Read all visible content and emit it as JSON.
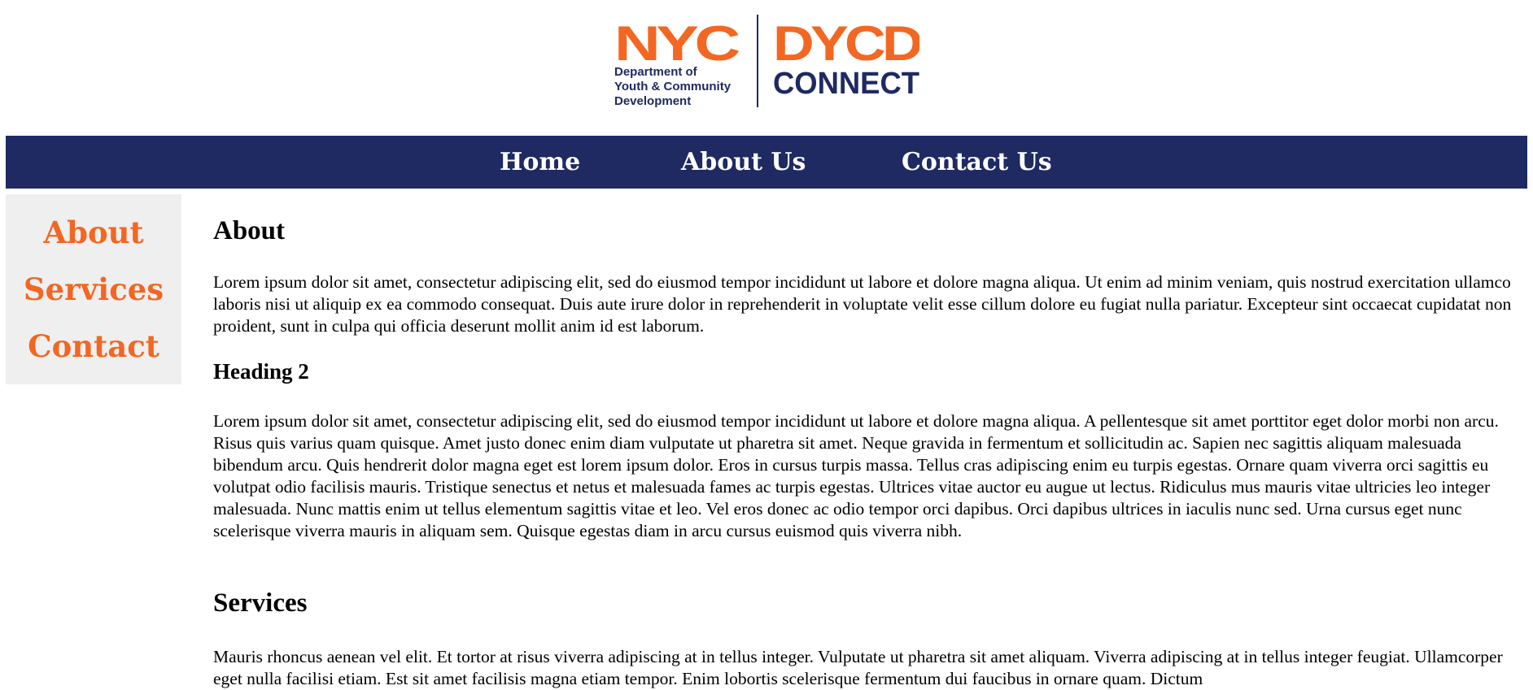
{
  "logo": {
    "nyc": "NYC",
    "dept_lines": [
      "Department of",
      "Youth & Community",
      "Development"
    ],
    "dycd": "DYCD",
    "connect": "CONNECT",
    "orange": "#F26722",
    "navy": "#1F2A63"
  },
  "nav": {
    "items": [
      {
        "label": "Home"
      },
      {
        "label": "About Us"
      },
      {
        "label": "Contact Us"
      }
    ],
    "background": "#1F2A63"
  },
  "sidebar": {
    "items": [
      {
        "label": "About"
      },
      {
        "label": "Services"
      },
      {
        "label": "Contact"
      }
    ],
    "accent": "#F26722",
    "background": "#EFEFEF"
  },
  "main": {
    "about_heading": "About",
    "about_text": "Lorem ipsum dolor sit amet, consectetur adipiscing elit, sed do eiusmod tempor incididunt ut labore et dolore magna aliqua. Ut enim ad minim veniam, quis nostrud exercitation ullamco laboris nisi ut aliquip ex ea commodo consequat. Duis aute irure dolor in reprehenderit in voluptate velit esse cillum dolore eu fugiat nulla pariatur. Excepteur sint occaecat cupidatat non proident, sunt in culpa qui officia deserunt mollit anim id est laborum.",
    "heading2": "Heading 2",
    "heading2_text": "Lorem ipsum dolor sit amet, consectetur adipiscing elit, sed do eiusmod tempor incididunt ut labore et dolore magna aliqua. A pellentesque sit amet porttitor eget dolor morbi non arcu. Risus quis varius quam quisque. Amet justo donec enim diam vulputate ut pharetra sit amet. Neque gravida in fermentum et sollicitudin ac. Sapien nec sagittis aliquam malesuada bibendum arcu. Quis hendrerit dolor magna eget est lorem ipsum dolor. Eros in cursus turpis massa. Tellus cras adipiscing enim eu turpis egestas. Ornare quam viverra orci sagittis eu volutpat odio facilisis mauris. Tristique senectus et netus et malesuada fames ac turpis egestas. Ultrices vitae auctor eu augue ut lectus. Ridiculus mus mauris vitae ultricies leo integer malesuada. Nunc mattis enim ut tellus elementum sagittis vitae et leo. Vel eros donec ac odio tempor orci dapibus. Orci dapibus ultrices in iaculis nunc sed. Urna cursus eget nunc scelerisque viverra mauris in aliquam sem. Quisque egestas diam in arcu cursus euismod quis viverra nibh.",
    "services_heading": "Services",
    "services_text": "Mauris rhoncus aenean vel elit. Et tortor at risus viverra adipiscing at in tellus integer. Vulputate ut pharetra sit amet aliquam. Viverra adipiscing at in tellus integer feugiat. Ullamcorper eget nulla facilisi etiam. Est sit amet facilisis magna etiam tempor. Enim lobortis scelerisque fermentum dui faucibus in ornare quam. Dictum"
  }
}
